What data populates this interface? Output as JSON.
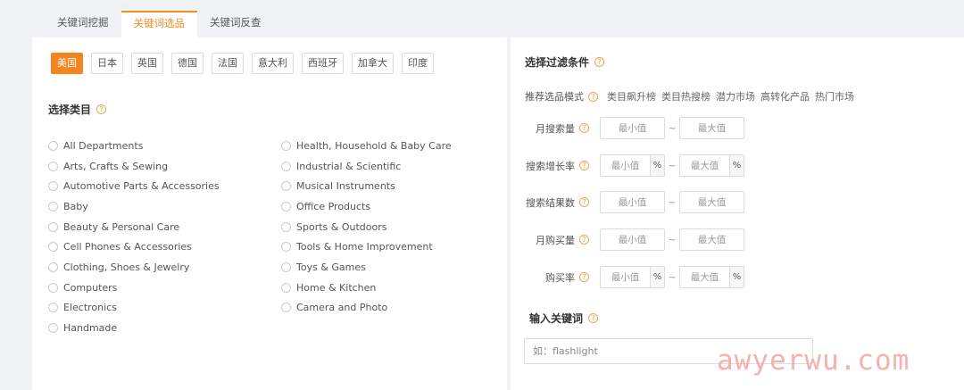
{
  "tabs": [
    "关键词挖掘",
    "关键词选品",
    "关键词反查"
  ],
  "countries": [
    "美国",
    "日本",
    "英国",
    "德国",
    "法国",
    "意大利",
    "西班牙",
    "加拿大",
    "印度"
  ],
  "category_section": {
    "title": "选择类目",
    "help": "?"
  },
  "categories_left": [
    "All Departments",
    "Arts, Crafts & Sewing",
    "Automotive Parts & Accessories",
    "Baby",
    "Beauty & Personal Care",
    "Cell Phones & Accessories",
    "Clothing, Shoes & Jewelry",
    "Computers",
    "Electronics",
    "Handmade"
  ],
  "categories_right": [
    "Health, Household & Baby Care",
    "Industrial & Scientific",
    "Musical Instruments",
    "Office Products",
    "Sports & Outdoors",
    "Tools & Home Improvement",
    "Toys & Games",
    "Home & Kitchen",
    "Camera and Photo"
  ],
  "filter_section": {
    "title": "选择过滤条件",
    "help": "?"
  },
  "mode": {
    "label": "推荐选品模式",
    "options": [
      "类目飙升榜",
      "类目热搜榜",
      "潜力市场",
      "高转化产品",
      "热门市场"
    ]
  },
  "filters": {
    "monthly_search": {
      "label": "月搜索量",
      "min": "最小值",
      "max": "最大值",
      "tilde": "~"
    },
    "search_growth": {
      "label": "搜索增长率",
      "min": "最小值",
      "max": "最大值",
      "unit": "%",
      "tilde": "~"
    },
    "search_results": {
      "label": "搜索结果数",
      "min": "最小值",
      "max": "最大值",
      "tilde": "~"
    },
    "monthly_purchase": {
      "label": "月购买量",
      "min": "最小值",
      "max": "最大值",
      "tilde": "~"
    },
    "purchase_rate": {
      "label": "购买率",
      "min": "最小值",
      "max": "最大值",
      "unit": "%",
      "tilde": "~"
    }
  },
  "keyword": {
    "title": "输入关键词",
    "help": "?",
    "placeholder": "如：flashlight"
  },
  "watermark": "awyerwu.com"
}
